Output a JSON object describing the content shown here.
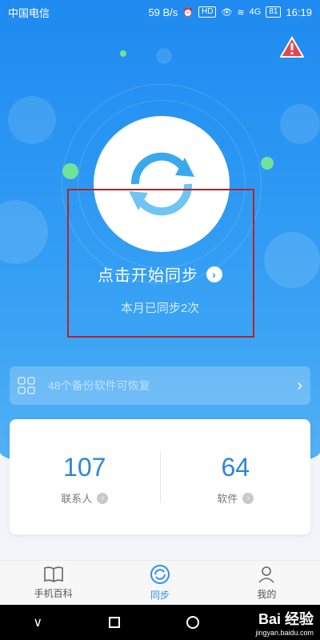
{
  "status_bar": {
    "carrier": "中国电信",
    "speed": "59 B/s",
    "hd": "HD",
    "signal_label": "4G",
    "battery": "81",
    "time": "16:19"
  },
  "sync": {
    "start_label": "点击开始同步",
    "month_text": "本月已同步2次"
  },
  "backup_bar": {
    "text": "48个备份软件可恢复"
  },
  "stats": [
    {
      "value": "107",
      "label": "联系人"
    },
    {
      "value": "64",
      "label": "软件"
    }
  ],
  "tabs": [
    {
      "label": "手机百科",
      "icon": "book-icon"
    },
    {
      "label": "同步",
      "icon": "sync-icon"
    },
    {
      "label": "我的",
      "icon": "person-icon"
    }
  ],
  "watermark": {
    "brand": "Bai 经验",
    "url": "jingyan.baidu.com"
  },
  "colors": {
    "accent": "#2b97f3",
    "number": "#2d86db",
    "warning": "#e8454a",
    "highlight_box": "#b3232b"
  }
}
